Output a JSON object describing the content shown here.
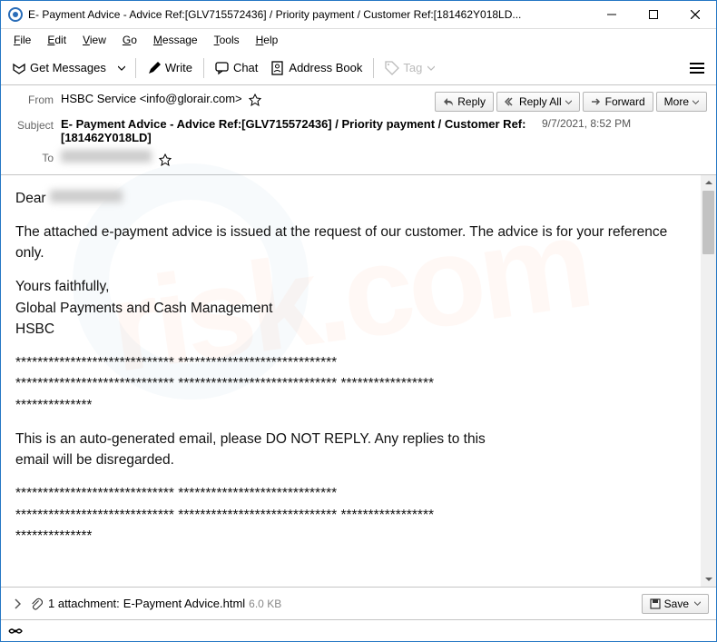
{
  "window": {
    "title": "E- Payment Advice - Advice Ref:[GLV715572436] / Priority payment / Customer Ref:[181462Y018LD..."
  },
  "menu": {
    "file": "File",
    "edit": "Edit",
    "view": "View",
    "go": "Go",
    "message": "Message",
    "tools": "Tools",
    "help": "Help"
  },
  "toolbar": {
    "get_messages": "Get Messages",
    "write": "Write",
    "chat": "Chat",
    "address_book": "Address Book",
    "tag": "Tag"
  },
  "headers": {
    "from_label": "From",
    "from_value": "HSBC Service <info@glorair.com>",
    "subject_label": "Subject",
    "subject_value": "E- Payment Advice - Advice Ref:[GLV715572436] / Priority payment / Customer Ref:[181462Y018LD]",
    "to_label": "To",
    "date": "9/7/2021, 8:52 PM"
  },
  "actions": {
    "reply": "Reply",
    "reply_all": "Reply All",
    "forward": "Forward",
    "more": "More"
  },
  "body": {
    "greeting": "Dear",
    "p1": "The attached e-payment advice is issued at the request of our customer. The advice is for your reference only.",
    "sig1": "Yours faithfully,",
    "sig2": "Global Payments and Cash Management",
    "sig3": "HSBC",
    "sep1": "***************************** *****************************",
    "sep2": "***************************** ***************************** *****************",
    "sep3": "**************",
    "p2": "This is an auto-generated email, please DO NOT REPLY. Any replies to this",
    "p3": "email will be disregarded.",
    "sep4": "***************************** *****************************",
    "sep5": "***************************** ***************************** *****************",
    "sep6": "**************"
  },
  "attachment": {
    "count_text": "1 attachment:",
    "filename": "E-Payment Advice.html",
    "size": "6.0 KB",
    "save": "Save"
  }
}
